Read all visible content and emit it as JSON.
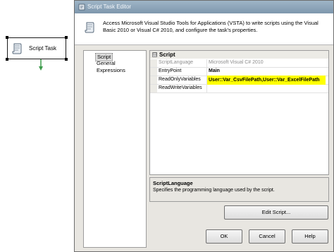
{
  "canvas": {
    "task_label": "Script Task"
  },
  "dialog": {
    "title": "Script Task Editor",
    "header_description": "Access Microsoft Visual Studio Tools for Applications (VSTA) to write scripts using the Visual Basic 2010 or Visual C# 2010, and configure the task's properties.",
    "nav_items": [
      {
        "label": "Script"
      },
      {
        "label": "General"
      },
      {
        "label": "Expressions"
      }
    ],
    "property_grid": {
      "section_label": "Script",
      "section_expander": "⊟",
      "rows": [
        {
          "name": "ScriptLanguage",
          "value": "Microsoft Visual C# 2010"
        },
        {
          "name": "EntryPoint",
          "value": "Main"
        },
        {
          "name": "ReadOnlyVariables",
          "value": "User::Var_CsvFilePath,User::Var_ExcelFilePath"
        },
        {
          "name": "ReadWriteVariables",
          "value": ""
        }
      ]
    },
    "description": {
      "title": "ScriptLanguage",
      "text": "Specifies the programming language used by the script."
    },
    "buttons": {
      "edit_script": "Edit Script...",
      "ok": "OK",
      "cancel": "Cancel",
      "help": "Help"
    },
    "colors": {
      "highlight": "#ffff00",
      "titlebar": "#8aa3b8",
      "arrow": "#3c9a4a"
    }
  }
}
